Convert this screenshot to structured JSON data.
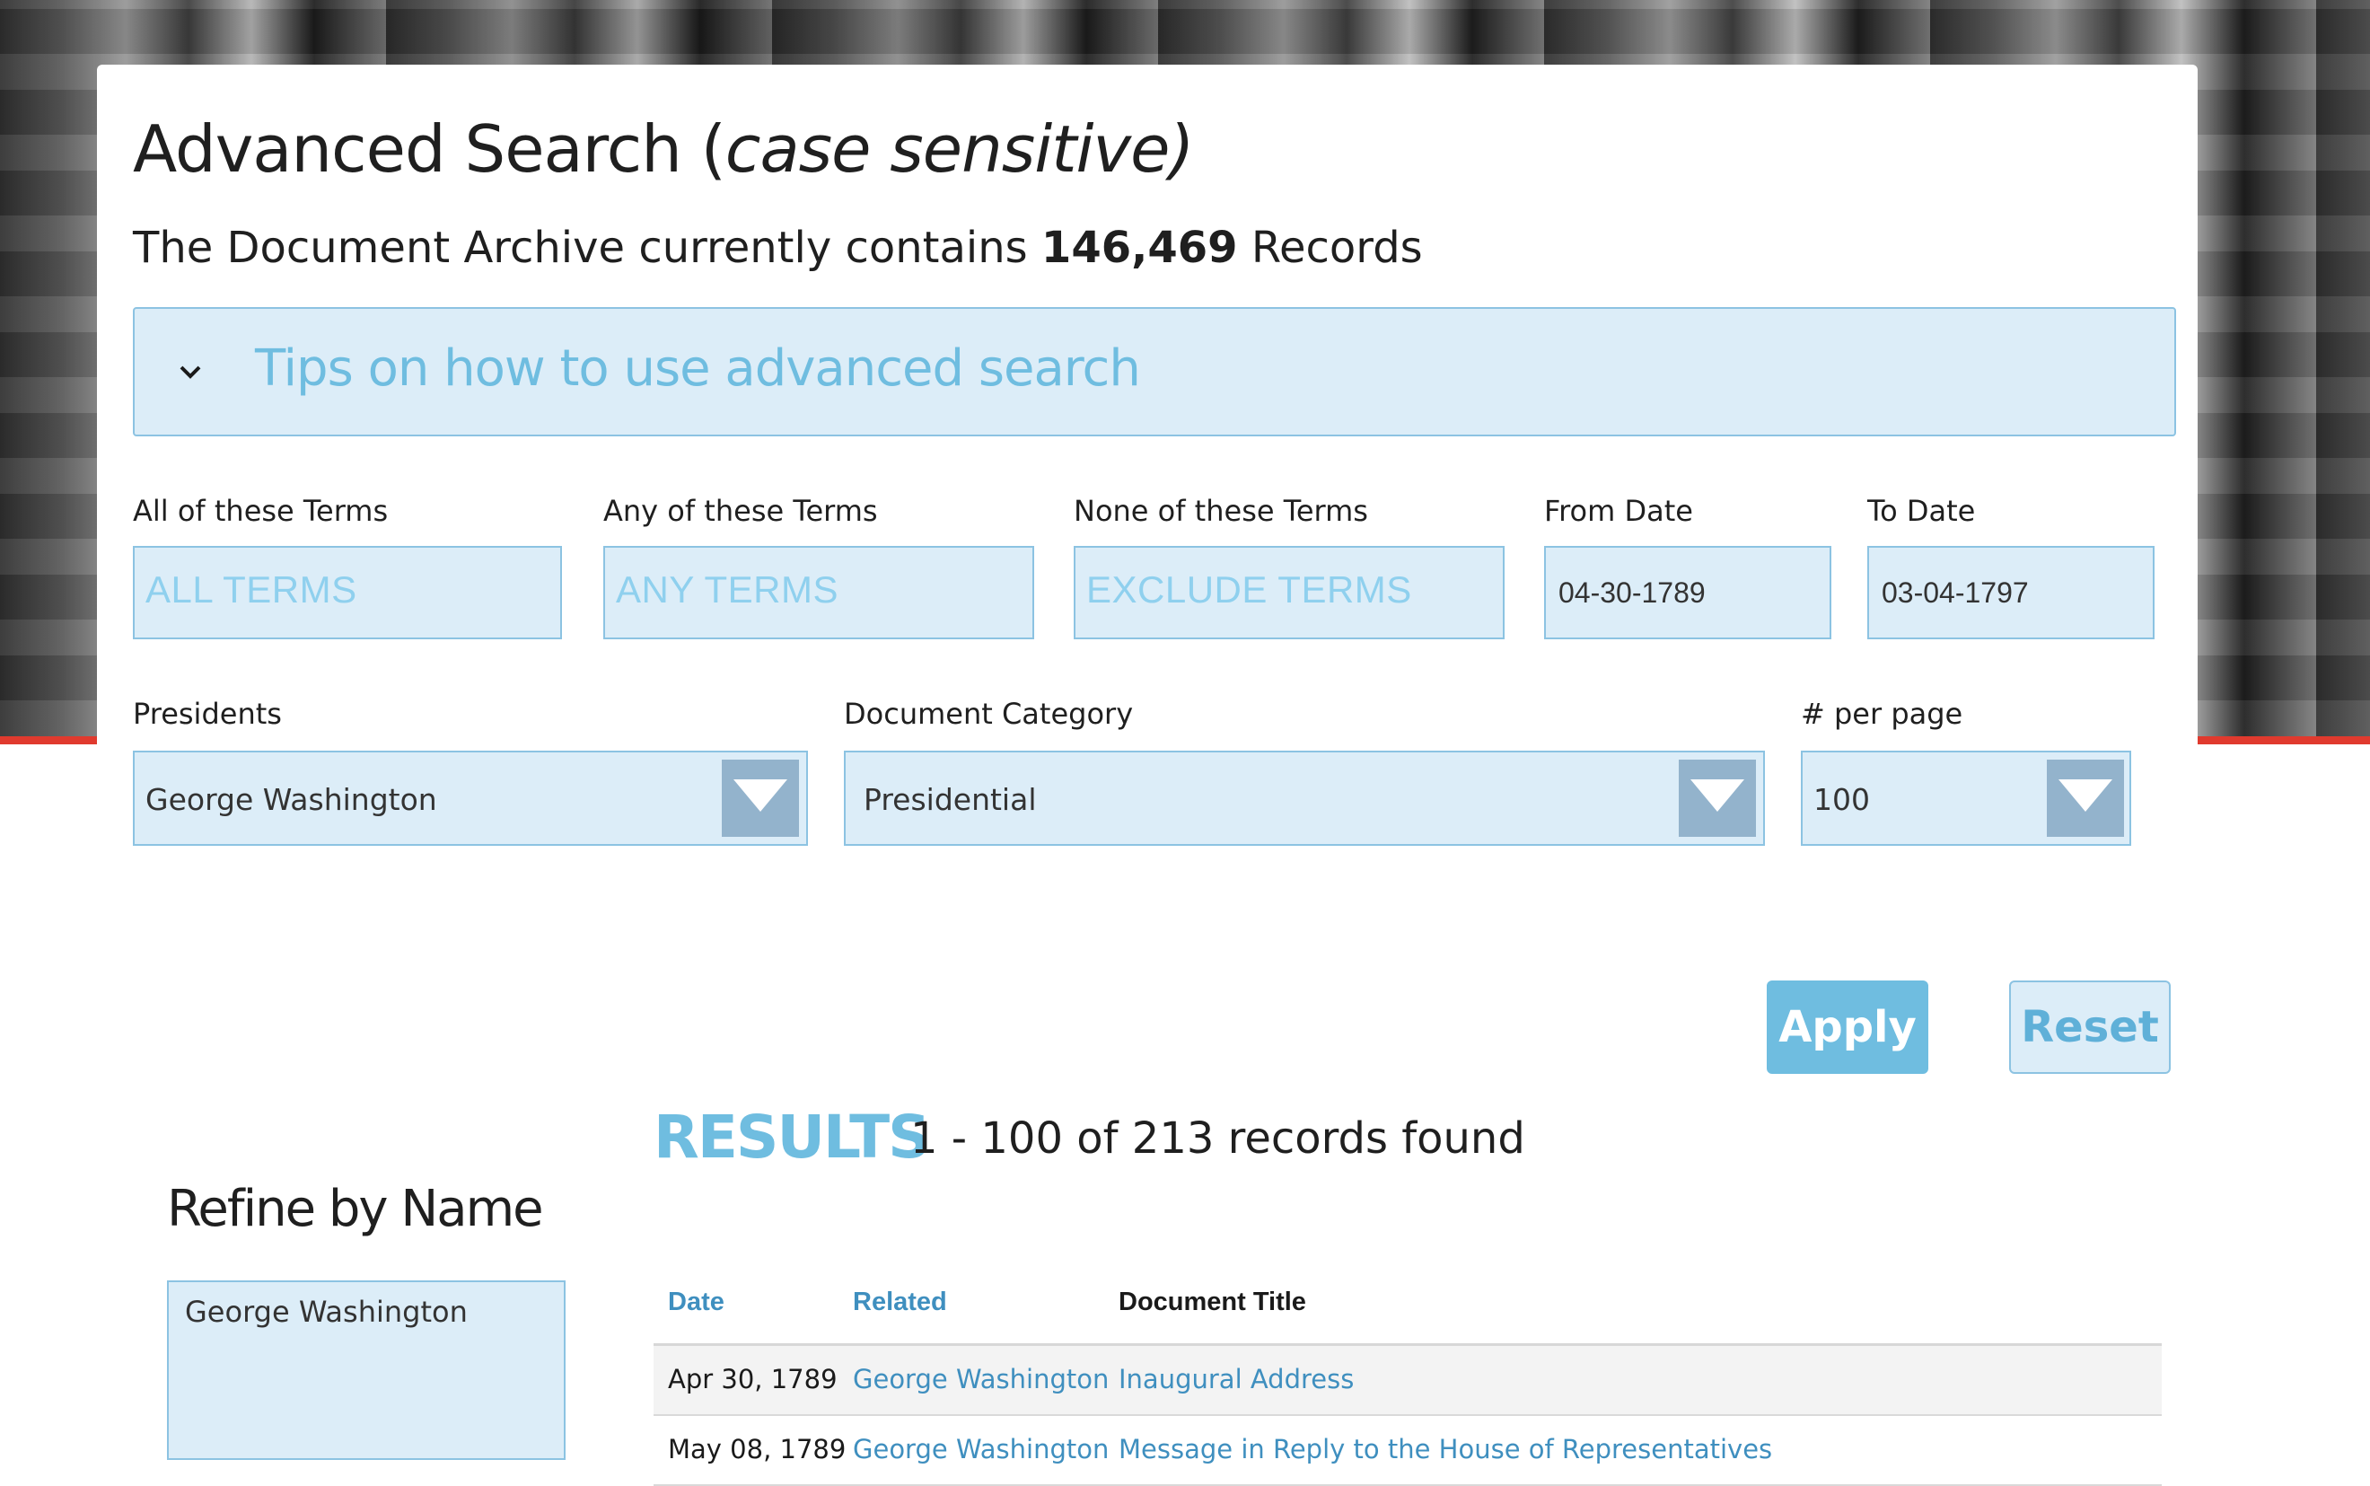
{
  "page": {
    "title_main": "Advanced Search (",
    "title_em": "case sensitive)",
    "archive_prefix": "The Document Archive currently contains",
    "archive_count": "146,469",
    "archive_suffix": "Records"
  },
  "tips": {
    "label": "Tips on how to use advanced search",
    "icon": "chevron-down-icon"
  },
  "filters": {
    "all_terms": {
      "label": "All of these Terms",
      "placeholder": "ALL TERMS",
      "value": ""
    },
    "any_terms": {
      "label": "Any of these Terms",
      "placeholder": "ANY TERMS",
      "value": ""
    },
    "none_terms": {
      "label": "None of these Terms",
      "placeholder": "EXCLUDE TERMS",
      "value": ""
    },
    "from_date": {
      "label": "From Date",
      "value": "04-30-1789"
    },
    "to_date": {
      "label": "To Date",
      "value": "03-04-1797"
    },
    "presidents": {
      "label": "Presidents",
      "value": "George Washington"
    },
    "category": {
      "label": "Document Category",
      "value": "Presidential"
    },
    "per_page": {
      "label": "# per page",
      "value": "100"
    }
  },
  "buttons": {
    "apply": "Apply",
    "reset": "Reset"
  },
  "refine": {
    "title": "Refine by Name",
    "value": "George Washington"
  },
  "results": {
    "heading": "RESULTS",
    "count_text": "1 - 100 of 213 records found",
    "columns": {
      "date": "Date",
      "related": "Related",
      "title": "Document Title"
    },
    "rows": [
      {
        "date": "Apr 30, 1789",
        "related": "George Washington",
        "title": "Inaugural Address"
      },
      {
        "date": "May 08, 1789",
        "related": "George Washington",
        "title": "Message in Reply to the House of Representatives"
      }
    ]
  },
  "colors": {
    "accent": "#6fbde0",
    "field_bg": "#dcedf8",
    "link": "#3f8fbf",
    "brand_red": "#e03a2e"
  }
}
